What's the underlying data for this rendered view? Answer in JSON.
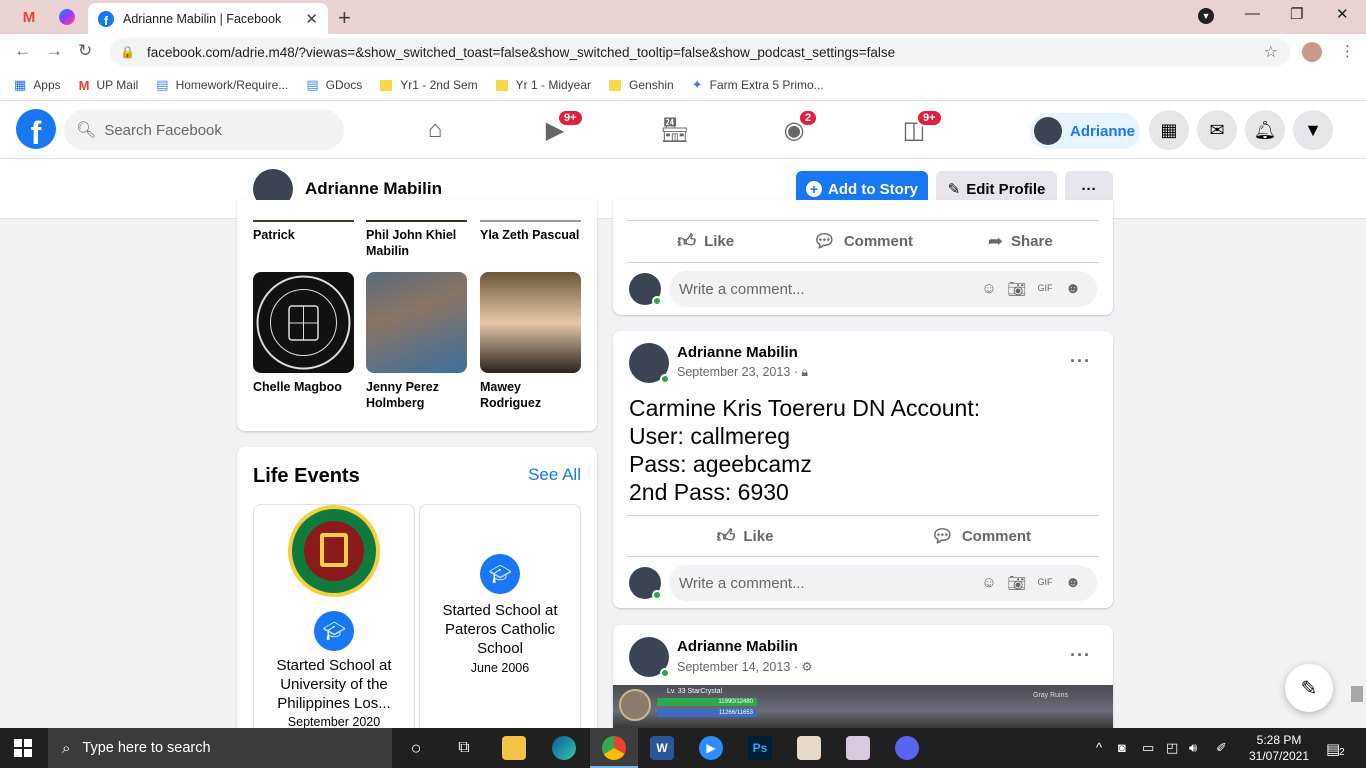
{
  "browser": {
    "tab_title": "Adrianne Mabilin | Facebook",
    "url": "facebook.com/adrie.m48/?viewas=&show_switched_toast=false&show_switched_tooltip=false&show_podcast_settings=false",
    "bookmarks": [
      {
        "label": "Apps",
        "icon": "apps-grid-icon"
      },
      {
        "label": "UP Mail",
        "icon": "gmail-icon"
      },
      {
        "label": "Homework/Require...",
        "icon": "docs-icon"
      },
      {
        "label": "GDocs",
        "icon": "docs-icon"
      },
      {
        "label": "Yr1 - 2nd Sem",
        "icon": "folder-icon"
      },
      {
        "label": "Yr 1 - Midyear",
        "icon": "folder-icon"
      },
      {
        "label": "Genshin",
        "icon": "folder-icon"
      },
      {
        "label": "Farm Extra 5 Primo...",
        "icon": "game-icon"
      }
    ]
  },
  "header": {
    "search_placeholder": "Search Facebook",
    "badges": {
      "watch": "9+",
      "groups": "2",
      "gaming": "9+"
    },
    "profile_name": "Adrianne"
  },
  "profile_bar": {
    "name": "Adrianne Mabilin",
    "add_story": "Add to Story",
    "edit_profile": "Edit Profile"
  },
  "friends": [
    {
      "name": "Patrick"
    },
    {
      "name": "Phil John Khiel Mabilin"
    },
    {
      "name": "Yla Zeth Pascual"
    },
    {
      "name": "Chelle Magboo"
    },
    {
      "name": "Jenny Perez Holmberg"
    },
    {
      "name": "Mawey Rodriguez"
    }
  ],
  "life_events": {
    "title": "Life Events",
    "see_all": "See All",
    "items": [
      {
        "title": "Started School at University of the Philippines Los...",
        "date": "September 2020"
      },
      {
        "title": "Started School at Pateros Catholic School",
        "date": "June 2006"
      }
    ]
  },
  "posts": [
    {
      "actions": {
        "like": "Like",
        "comment": "Comment",
        "share": "Share"
      },
      "comment_placeholder": "Write a comment..."
    },
    {
      "author": "Adrianne Mabilin",
      "date": "September 23, 2013 ·",
      "privacy_icon": "lock-icon",
      "body": [
        "Carmine Kris Toereru DN Account:",
        "User: callmereg",
        "Pass: ageebcamz",
        "2nd Pass: 6930"
      ],
      "actions": {
        "like": "Like",
        "comment": "Comment"
      },
      "comment_placeholder": "Write a comment..."
    },
    {
      "author": "Adrianne Mabilin",
      "date": "September 14, 2013 ·",
      "privacy_icon": "gear-icon",
      "image_labels": {
        "level": "Lv. 33 StarCrystal",
        "hp": "11990/12480",
        "mp": "11266/11653",
        "location": "Gray Ruins"
      }
    }
  ],
  "taskbar": {
    "search_placeholder": "Type here to search",
    "time": "5:28 PM",
    "date": "31/07/2021",
    "notifications": "2"
  },
  "colors": {
    "brand": "#1877f2",
    "badge": "#e41e3f",
    "online": "#31a24c"
  }
}
